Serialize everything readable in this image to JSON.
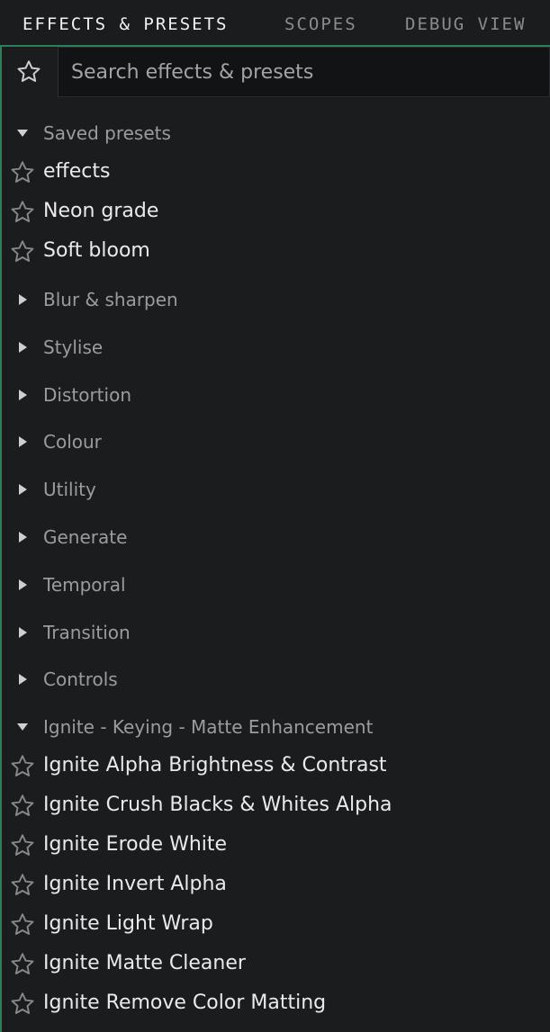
{
  "tabs": [
    {
      "label": "EFFECTS & PRESETS",
      "active": true
    },
    {
      "label": "SCOPES",
      "active": false
    },
    {
      "label": "DEBUG VIEW",
      "active": false
    }
  ],
  "search": {
    "placeholder": "Search effects & presets",
    "value": ""
  },
  "colors": {
    "accent": "#2f7d5b",
    "background": "#1b1c1e",
    "star_outline": "#8a8a8a"
  },
  "sections": [
    {
      "label": "Saved presets",
      "expanded": true,
      "items": [
        "effects",
        "Neon grade",
        "Soft bloom"
      ]
    },
    {
      "label": "Blur & sharpen",
      "expanded": false,
      "items": []
    },
    {
      "label": "Stylise",
      "expanded": false,
      "items": []
    },
    {
      "label": "Distortion",
      "expanded": false,
      "items": []
    },
    {
      "label": "Colour",
      "expanded": false,
      "items": []
    },
    {
      "label": "Utility",
      "expanded": false,
      "items": []
    },
    {
      "label": "Generate",
      "expanded": false,
      "items": []
    },
    {
      "label": "Temporal",
      "expanded": false,
      "items": []
    },
    {
      "label": "Transition",
      "expanded": false,
      "items": []
    },
    {
      "label": "Controls",
      "expanded": false,
      "items": []
    },
    {
      "label": "Ignite - Keying - Matte Enhancement",
      "expanded": true,
      "items": [
        "Ignite Alpha Brightness & Contrast",
        "Ignite Crush Blacks & Whites Alpha",
        "Ignite Erode White",
        "Ignite Invert Alpha",
        "Ignite Light Wrap",
        "Ignite Matte Cleaner",
        "Ignite Remove Color Matting"
      ]
    }
  ],
  "icons": {
    "favorites_toggle": "star-outline-icon",
    "item_favorite": "star-outline-icon",
    "expanded_caret": "triangle-down-icon",
    "collapsed_caret": "triangle-right-icon"
  }
}
